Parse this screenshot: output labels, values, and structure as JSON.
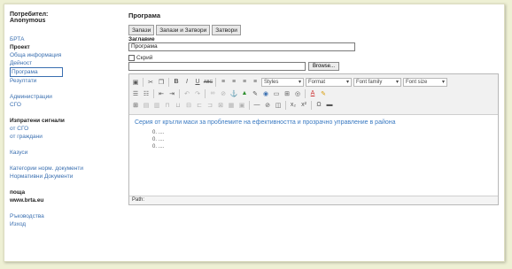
{
  "user": {
    "label": "Потребител:",
    "name": "Anonymous"
  },
  "sidebar": {
    "brta": "БРТА",
    "project_head": "Проект",
    "project_items": [
      "Обща информация",
      "Дейност",
      "Програма",
      "Резултати"
    ],
    "admin": [
      "Администрации",
      "СГО"
    ],
    "signals_head": "Изпратени сигнали",
    "signals_items": [
      "от СГО",
      "от граждани"
    ],
    "kazus": "Казуси",
    "docs": [
      "Категории норм. документи",
      "Нормативни Документи"
    ],
    "mail_head": "поща",
    "site": "www.brta.eu",
    "bottom": [
      "Ръководства",
      "Изход"
    ]
  },
  "main": {
    "title": "Програма",
    "buttons": {
      "save": "Запази",
      "save_close": "Запази и Затвори",
      "close": "Затвори"
    },
    "heading_label": "Заглавие",
    "heading_value": "Програма",
    "hide_label": "Скрий",
    "browse_label": "Browse..."
  },
  "toolbar": {
    "styles": "Styles",
    "format": "Format",
    "font_family": "Font family",
    "font_size": "Font size"
  },
  "editor": {
    "paragraph": "Серия от кръгли маси за проблемите на ефективността и прозрачно управление в района",
    "list_items": [
      "0.  ....",
      "0.  ....",
      "0.  ...."
    ],
    "path_label": "Path:"
  },
  "colors": {
    "link": "#3a6fb0",
    "content_text": "#3a7ac2",
    "page_bg": "#eef0d4"
  }
}
